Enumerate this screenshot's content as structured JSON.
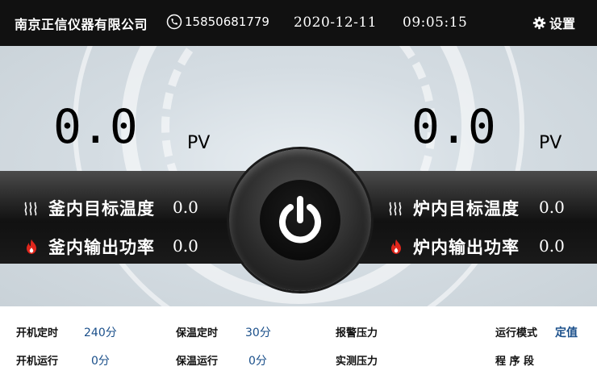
{
  "header": {
    "company": "南京正信仪器有限公司",
    "phone": "15850681779",
    "date": "2020-12-11",
    "time": "09:05:15",
    "settings_label": "设置",
    "icons": {
      "phone": "phone-icon",
      "settings": "gear-icon"
    }
  },
  "left": {
    "pv_value": "0.0",
    "pv_unit": "PV",
    "target_label": "釜内目标温度",
    "target_value": "0.0",
    "power_label": "釜内输出功率",
    "power_value": "0.0"
  },
  "right": {
    "pv_value": "0.0",
    "pv_unit": "PV",
    "target_label": "炉内目标温度",
    "target_value": "0.0",
    "power_label": "炉内输出功率",
    "power_value": "0.0"
  },
  "power_button": {
    "icon": "power-icon"
  },
  "footer": {
    "start_timer_label": "开机定时",
    "start_timer_value": "240分",
    "start_run_label": "开机运行",
    "start_run_value": "0分",
    "hold_timer_label": "保温定时",
    "hold_timer_value": "30分",
    "hold_run_label": "保温运行",
    "hold_run_value": "0分",
    "alarm_pressure_label": "报警压力",
    "actual_pressure_label": "实测压力",
    "run_mode_label": "运行模式",
    "run_mode_value": "定值",
    "program_segment_label": "程 序 段"
  },
  "colors": {
    "header_bg": "#111111",
    "value_blue": "#1a4f8a",
    "flame_red": "#e0261c",
    "band_dark": "#1a1a1a"
  }
}
